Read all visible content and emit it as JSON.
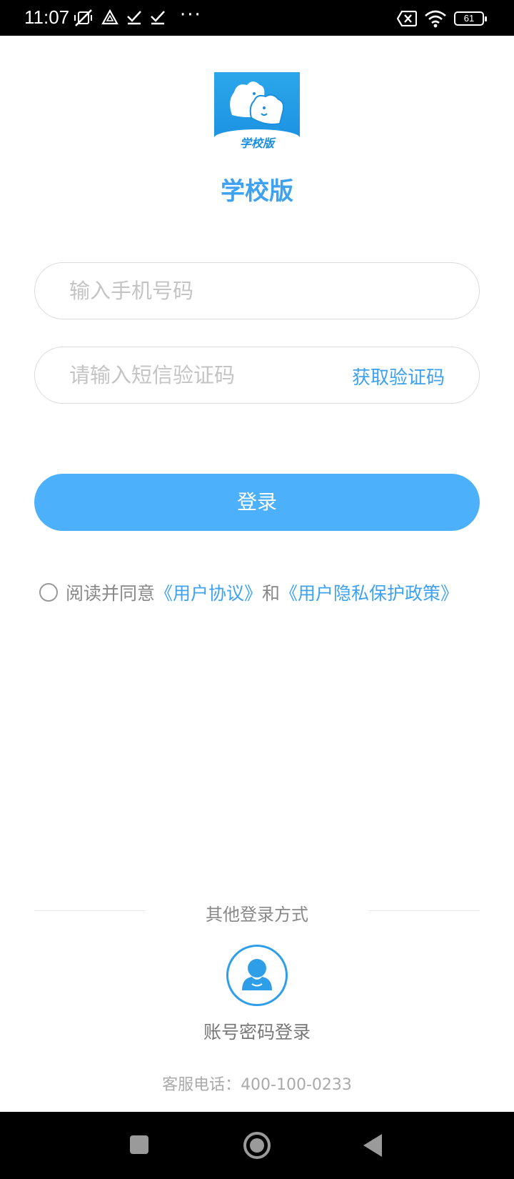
{
  "status_bar": {
    "time": "11:07",
    "dots": "···",
    "battery": "61",
    "icons": [
      "mute-vibrate-icon",
      "warning-triangle-icon",
      "check-icon",
      "check-icon",
      "sim-x-icon",
      "wifi-icon",
      "battery-icon"
    ]
  },
  "app": {
    "logo_text": "学校版",
    "title": "学校版"
  },
  "form": {
    "phone_placeholder": "输入手机号码",
    "phone_value": "",
    "code_placeholder": "请输入短信验证码",
    "code_value": "",
    "get_code_label": "获取验证码",
    "login_label": "登录"
  },
  "agreement": {
    "checked": false,
    "prefix": "阅读并同意",
    "user_agreement": "《用户协议》",
    "and": "和",
    "privacy_policy": "《用户隐私保护政策》"
  },
  "other_login": {
    "title": "其他登录方式",
    "account_label": "账号密码登录",
    "account_icon": "user-avatar-icon"
  },
  "footer": {
    "hotline": "客服电话：400-100-0233"
  },
  "nav": {
    "icons": [
      "recent-apps-icon",
      "home-icon",
      "back-icon"
    ]
  },
  "colors": {
    "accent": "#3ea2f0",
    "button": "#4db0fb",
    "logo_blue": "#1a8fe0"
  }
}
